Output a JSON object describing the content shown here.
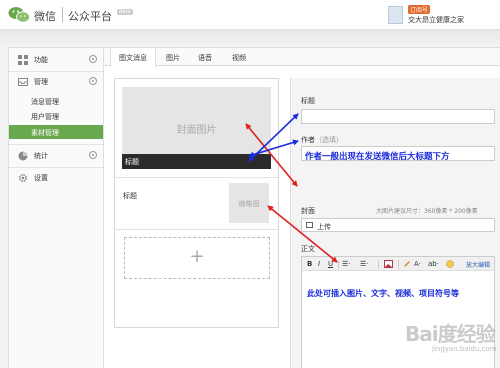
{
  "header": {
    "brand": "微信",
    "platform": "公众平台",
    "beta_badge": "Beta",
    "subscription_badge": "订阅号",
    "account_name": "交大昂立健康之家"
  },
  "sidebar": {
    "items": [
      {
        "label": "功能",
        "icon": "grid-icon"
      },
      {
        "label": "管理",
        "icon": "inbox-icon"
      },
      {
        "label": "统计",
        "icon": "pie-chart-icon"
      },
      {
        "label": "设置",
        "icon": "gear-icon"
      }
    ],
    "sub_items": [
      {
        "label": "消息管理"
      },
      {
        "label": "用户管理"
      },
      {
        "label": "素材管理",
        "active": true
      }
    ]
  },
  "tabs": [
    {
      "label": "图文消息",
      "active": true
    },
    {
      "label": "图片"
    },
    {
      "label": "语音"
    },
    {
      "label": "视频"
    }
  ],
  "preview": {
    "cover_text": "封面图片",
    "cover_title": "标题",
    "item_title": "标题",
    "thumb_text": "缩略图",
    "add_symbol": "+"
  },
  "form": {
    "title_label": "标题",
    "author_label": "作者",
    "author_hint": "（选填）",
    "author_annotation": "作者一般出现在发送微信后大标题下方",
    "cover_label": "封面",
    "cover_hint": "大图片建议尺寸：360像素 * 200像素",
    "upload_label": "上传",
    "body_label": "正文",
    "expand_editor": "放大编辑",
    "editor_annotation": "此处可插入图片、文字、视频、项目符号等"
  },
  "toolbar": {
    "bold": "B",
    "italic": "I",
    "underline": "U",
    "list1": "☰·",
    "list2": "☰·",
    "font_color": "A·",
    "bg_color": "ab·"
  },
  "watermark": {
    "main": "Bai度经验",
    "sub": "jingyan.baidu.com"
  },
  "colors": {
    "accent_green": "#6aa84f",
    "annotation_blue": "#1a2bd8",
    "arrow_red": "#e02020",
    "arrow_blue": "#1a2bd8"
  }
}
